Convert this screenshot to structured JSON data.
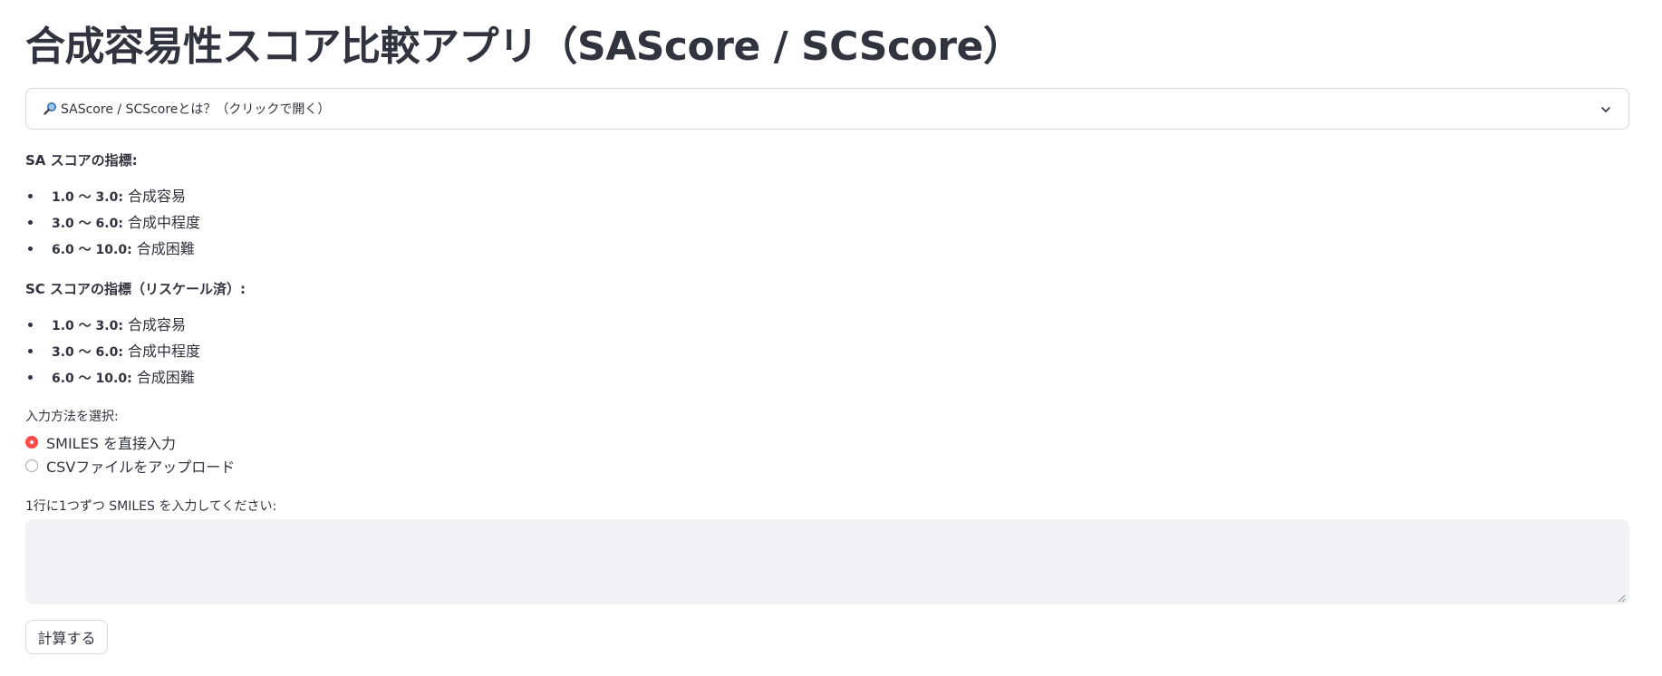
{
  "title": "合成容易性スコア比較アプリ（SAScore / SCScore）",
  "expander": {
    "icon": "magnifier-icon",
    "label": "SAScore / SCScoreとは？（クリックで開く）",
    "chevron": "chevron-down-icon"
  },
  "sa_section": {
    "heading": "SA スコアの指標:",
    "items": [
      {
        "range": "1.0 〜 3.0:",
        "text": "合成容易"
      },
      {
        "range": "3.0 〜 6.0:",
        "text": "合成中程度"
      },
      {
        "range": "6.0 〜 10.0:",
        "text": "合成困難"
      }
    ]
  },
  "sc_section": {
    "heading": "SC スコアの指標（リスケール済）:",
    "items": [
      {
        "range": "1.0 〜 3.0:",
        "text": "合成容易"
      },
      {
        "range": "3.0 〜 6.0:",
        "text": "合成中程度"
      },
      {
        "range": "6.0 〜 10.0:",
        "text": "合成困難"
      }
    ]
  },
  "input_method": {
    "label": "入力方法を選択:",
    "options": [
      {
        "label": "SMILES を直接入力",
        "selected": true
      },
      {
        "label": "CSVファイルをアップロード",
        "selected": false
      }
    ]
  },
  "smiles_input": {
    "label": "1行に1つずつ SMILES を入力してください:",
    "value": ""
  },
  "calculate_button": {
    "label": "計算する"
  },
  "colors": {
    "text": "#31333f",
    "accent": "#ff4b4b",
    "border": "#d6d8de",
    "input_bg": "#f0f2f6"
  }
}
